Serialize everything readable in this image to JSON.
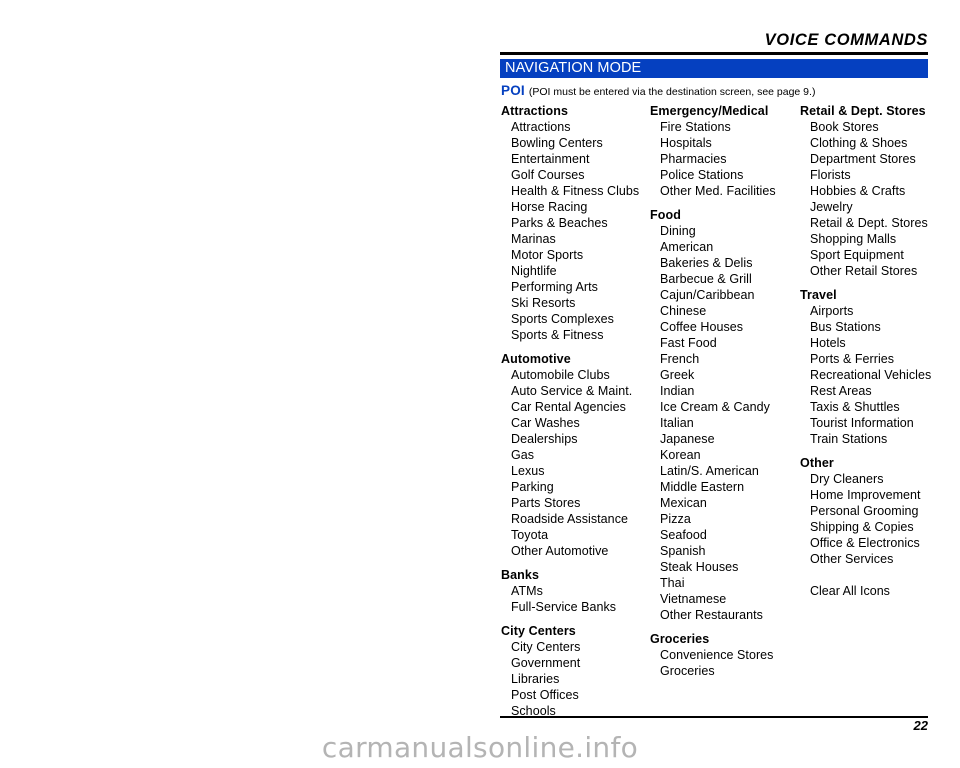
{
  "header": {
    "running_title": "VOICE COMMANDS",
    "section_bar_title": "NAVIGATION MODE",
    "poi_label": "POI",
    "poi_note": "(POI must be entered via the destination screen, see page 9.)"
  },
  "columns": [
    {
      "groups": [
        {
          "title": "Attractions",
          "items": [
            "Attractions",
            "Bowling Centers",
            "Entertainment",
            "Golf Courses",
            "Health & Fitness Clubs",
            "Horse Racing",
            "Parks & Beaches",
            "Marinas",
            "Motor Sports",
            "Nightlife",
            "Performing Arts",
            "Ski Resorts",
            "Sports Complexes",
            "Sports & Fitness"
          ]
        },
        {
          "title": "Automotive",
          "items": [
            "Automobile Clubs",
            "Auto Service & Maint.",
            "Car Rental Agencies",
            "Car Washes",
            "Dealerships",
            "Gas",
            "Lexus",
            "Parking",
            "Parts Stores",
            "Roadside Assistance",
            "Toyota",
            "Other Automotive"
          ]
        },
        {
          "title": "Banks",
          "items": [
            "ATMs",
            "Full-Service Banks"
          ]
        },
        {
          "title": "City Centers",
          "items": [
            "City Centers",
            "Government",
            "Libraries",
            "Post Offices",
            "Schools"
          ]
        }
      ]
    },
    {
      "groups": [
        {
          "title": "Emergency/Medical",
          "items": [
            "Fire Stations",
            "Hospitals",
            "Pharmacies",
            "Police Stations",
            "Other Med. Facilities"
          ]
        },
        {
          "title": "Food",
          "items": [
            "Dining",
            "American",
            "Bakeries & Delis",
            "Barbecue & Grill",
            "Cajun/Caribbean",
            "Chinese",
            "Coffee Houses",
            "Fast Food",
            "French",
            "Greek",
            "Indian",
            "Ice Cream & Candy",
            "Italian",
            "Japanese",
            "Korean",
            "Latin/S. American",
            "Middle Eastern",
            "Mexican",
            "Pizza",
            "Seafood",
            "Spanish",
            "Steak Houses",
            "Thai",
            "Vietnamese",
            "Other Restaurants"
          ]
        },
        {
          "title": "Groceries",
          "items": [
            "Convenience Stores",
            "Groceries"
          ]
        }
      ]
    },
    {
      "groups": [
        {
          "title": "Retail & Dept. Stores",
          "items": [
            "Book Stores",
            "Clothing & Shoes",
            "Department Stores",
            "Florists",
            "Hobbies & Crafts",
            "Jewelry",
            "Retail & Dept. Stores",
            "Shopping Malls",
            "Sport Equipment",
            "Other Retail Stores"
          ]
        },
        {
          "title": "Travel",
          "items": [
            "Airports",
            "Bus Stations",
            "Hotels",
            "Ports & Ferries",
            "Recreational Vehicles",
            "Rest Areas",
            "Taxis & Shuttles",
            "Tourist Information",
            "Train Stations"
          ]
        },
        {
          "title": "Other",
          "items": [
            "Dry Cleaners",
            "Home Improvement",
            "Personal Grooming",
            "Shipping & Copies",
            "Office & Electronics",
            "Other Services"
          ]
        }
      ],
      "standalone_items": [
        "Clear All Icons"
      ]
    }
  ],
  "footer": {
    "page_number": "22",
    "watermark": "carmanualsonline.info"
  },
  "colors": {
    "accent_blue": "#0540c0",
    "text": "#000000",
    "watermark_gray": "#b4b4b4",
    "page_background": "#ffffff"
  }
}
